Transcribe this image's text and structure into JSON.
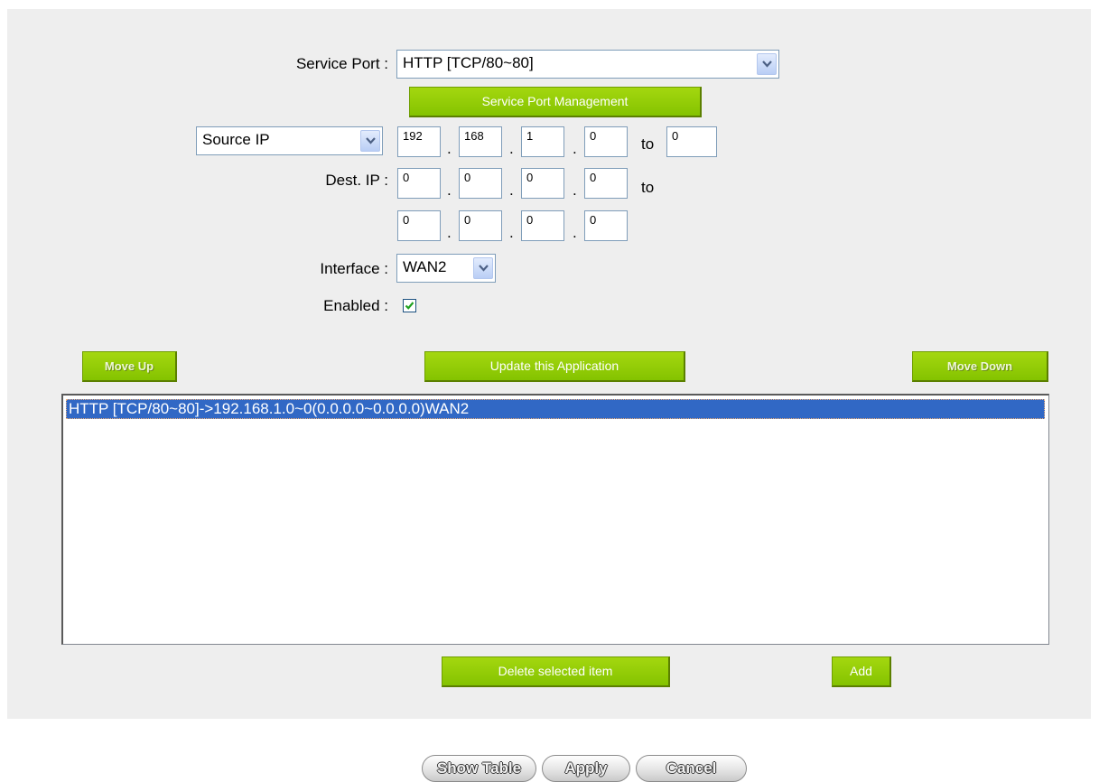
{
  "form": {
    "service_port_label": "Service Port :",
    "service_port_value": "HTTP [TCP/80~80]",
    "service_port_mgmt_button": "Service Port Management",
    "source_type_value": "Source IP",
    "source_ip": [
      "192",
      "168",
      "1",
      "0"
    ],
    "source_to_label": "to",
    "source_ip_end": "0",
    "dest_label": "Dest. IP :",
    "dest_ip_start": [
      "0",
      "0",
      "0",
      "0"
    ],
    "dest_to_label": "to",
    "dest_ip_end": [
      "0",
      "0",
      "0",
      "0"
    ],
    "ip_separator": ".",
    "interface_label": "Interface :",
    "interface_value": "WAN2",
    "enabled_label": "Enabled :",
    "enabled_checked": true
  },
  "actions": {
    "move_up": "Move Up",
    "update": "Update this Application",
    "move_down": "Move Down",
    "delete": "Delete selected item",
    "add": "Add"
  },
  "rules_list": {
    "items": [
      "HTTP [TCP/80~80]->192.168.1.0~0(0.0.0.0~0.0.0.0)WAN2"
    ],
    "selected_index": 0
  },
  "footer": {
    "show_table": "Show Table",
    "apply": "Apply",
    "cancel": "Cancel"
  },
  "colors": {
    "panel_bg": "#eeeeee",
    "button_green": "#8cc700",
    "selection_blue": "#3168c5"
  }
}
